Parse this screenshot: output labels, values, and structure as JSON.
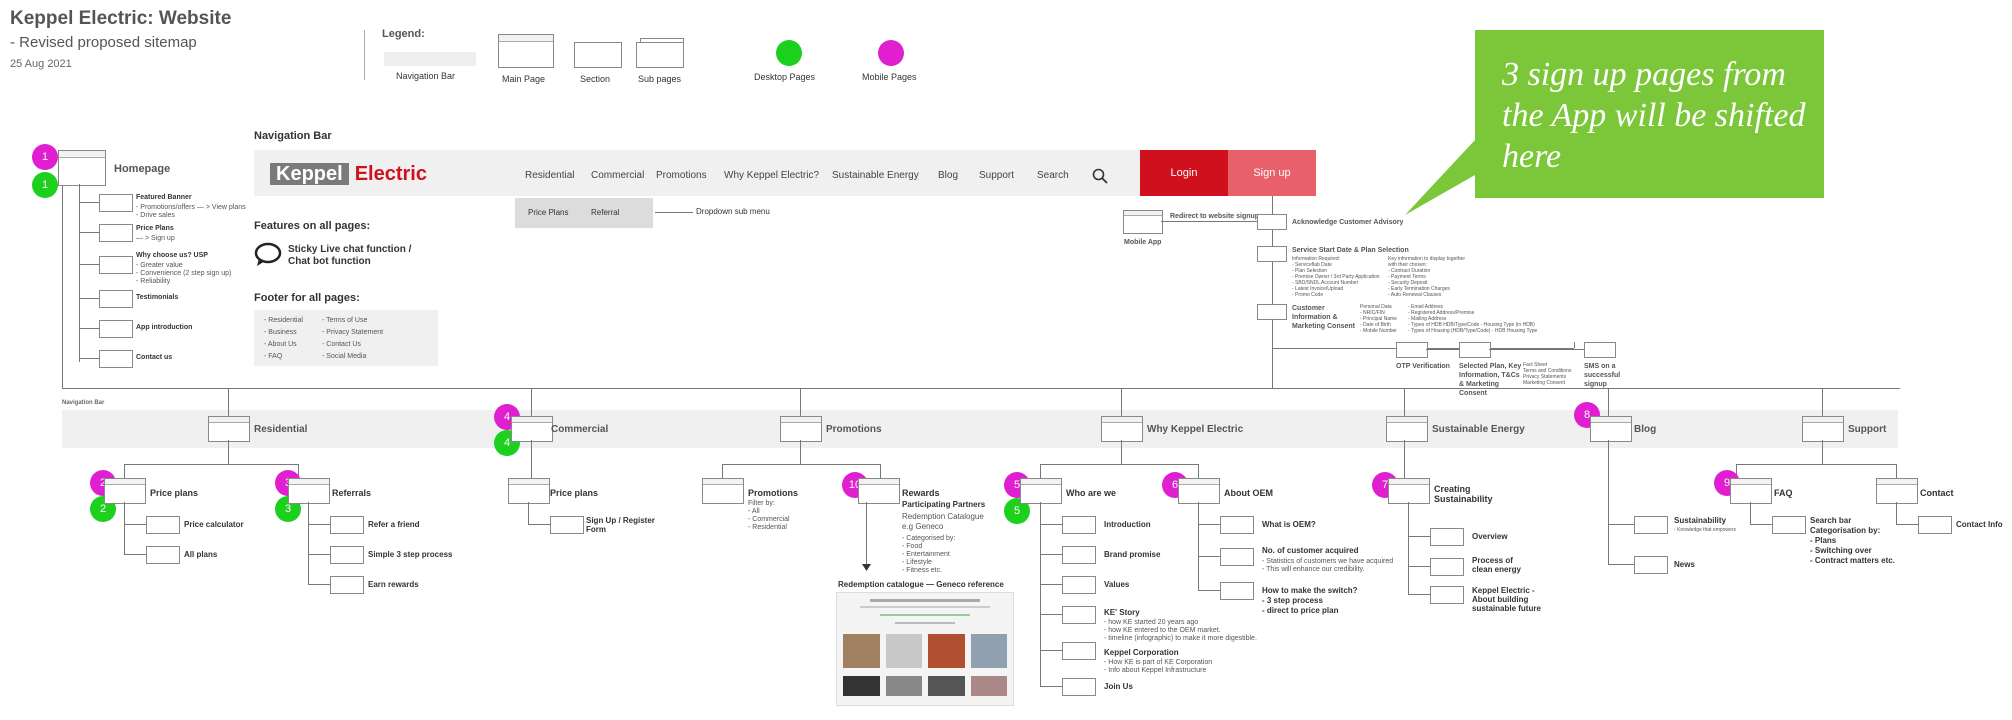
{
  "header": {
    "title": "Keppel Electric: Website",
    "subtitle": "- Revised proposed sitemap",
    "date": "25 Aug 2021"
  },
  "legend": {
    "title": "Legend:",
    "items": [
      "Navigation Bar",
      "Main Page",
      "Section",
      "Sub pages",
      "Desktop Pages",
      "Mobile Pages"
    ]
  },
  "callout": {
    "text": "3 sign up pages from the App will be shifted here",
    "color": "#7cc63a"
  },
  "navbar": {
    "section_label": "Navigation Bar",
    "logo_k": "Keppel",
    "logo_e": "Electric",
    "items": [
      "Residential",
      "Commercial",
      "Promotions",
      "Why Keppel Electric?",
      "Sustainable Energy",
      "Blog",
      "Support",
      "Search"
    ],
    "login": "Login",
    "signup": "Sign up",
    "dropdown": [
      "Price Plans",
      "Referral"
    ],
    "dropdown_label": "Dropdown sub menu",
    "colors": {
      "login": "#d0101c",
      "signup": "#e8606a",
      "logo": "#d0101c"
    }
  },
  "features": {
    "title": "Features on all pages:",
    "chat": "Sticky Live chat function / Chat bot function"
  },
  "footer": {
    "title": "Footer for all pages:",
    "col1": [
      "- Residential",
      "- Business",
      "- About Us",
      "- FAQ"
    ],
    "col2": [
      "- Terms of Use",
      "- Privacy Statement",
      "- Contact Us",
      "- Social Media"
    ]
  },
  "homepage": {
    "label": "Homepage",
    "mobile_num": "1",
    "desktop_num": "1",
    "sections": [
      {
        "title": "Featured Banner",
        "lines": [
          "- Promotions/offers  — > View plans",
          "- Drive sales"
        ]
      },
      {
        "title": "Price Plans",
        "lines": [
          "— > Sign up"
        ]
      },
      {
        "title": "Why choose us? USP",
        "lines": [
          "- Greater value",
          "- Convenience (2 step sign up)",
          "- Reliability"
        ]
      },
      {
        "title": "Testimonials",
        "lines": []
      },
      {
        "title": "App introduction",
        "lines": []
      },
      {
        "title": "Contact us",
        "lines": []
      }
    ]
  },
  "signup_flow": {
    "mobile_app": "Mobile App",
    "redirect": "Redirect to website signup",
    "steps": [
      {
        "title": "Acknowledge Customer Advisory",
        "lines": []
      },
      {
        "title": "Service Start Date & Plan Selection",
        "lines": [
          "Information Required:",
          "- Serviceflab Date",
          "- Plan Selection",
          "- Premise Owner / 3rd Party Application",
          "- SBD/SNDL Account Number",
          "- Latest Invoice/Upload",
          "- Promo Code"
        ]
      },
      {
        "title": "Customer Information & Marketing Consent",
        "lines": [
          "Personal Data",
          "- NRIC/FIN",
          "- Principal Name",
          "- Date of Birth",
          "- Mobile Number"
        ]
      }
    ],
    "key_info": [
      "Key information to display together",
      "with their chosen:",
      "- Contract Duration",
      "- Payment Terms",
      "- Security Deposit",
      "- Early Termination Charges",
      "- Auto Renewal Clauses"
    ],
    "personal_extra": [
      "- Email Address",
      "- Registered Address/Premise",
      "- Mailing Address",
      "- Types of HDB HDB/Type/Code - Housing Type (in HDB)",
      "- Types of Housing (HDB/Type/Code) - HDB Housing Type"
    ],
    "bottom": [
      {
        "title": "OTP Verification"
      },
      {
        "title": "Selected Plan, Key Information, T&Cs & Marketing Consent"
      },
      {
        "title": "SMS on a successful signup"
      }
    ],
    "fact_sheet": [
      "Fact Sheet",
      "Terms and Conditions",
      "Privacy Statements",
      "Marketing Consent"
    ]
  },
  "nav_bar_band": "Navigation Bar",
  "main_pages": [
    {
      "label": "Residential",
      "mobile_num": "",
      "desktop_num": ""
    },
    {
      "label": "Commercial",
      "mobile_num": "4",
      "desktop_num": "4"
    },
    {
      "label": "Promotions",
      "mobile_num": "",
      "desktop_num": ""
    },
    {
      "label": "Why Keppel Electric",
      "mobile_num": "",
      "desktop_num": ""
    },
    {
      "label": "Sustainable Energy",
      "mobile_num": "",
      "desktop_num": ""
    },
    {
      "label": "Blog",
      "mobile_num": "8",
      "desktop_num": ""
    },
    {
      "label": "Support",
      "mobile_num": "",
      "desktop_num": ""
    }
  ],
  "residential": {
    "price_plans": {
      "label": "Price plans",
      "mobile_num": "2",
      "desktop_num": "2",
      "subs": [
        "Price calculator",
        "All plans"
      ]
    },
    "referrals": {
      "label": "Referrals",
      "mobile_num": "3",
      "desktop_num": "3",
      "subs": [
        "Refer a friend",
        "Simple 3 step process",
        "Earn rewards"
      ]
    }
  },
  "commercial": {
    "price_plans": "Price plans",
    "sub": "Sign Up / Register Form"
  },
  "promotions": {
    "label": "Promotions",
    "filter": [
      "Filter by:",
      "- All",
      "- Commercial",
      "- Residential"
    ],
    "rewards": {
      "label": "Rewards",
      "num": "10",
      "partners": "Participating Partners",
      "catalogue": "Redemption Catalogue e.g Geneco",
      "cats": [
        "- Categorised by:",
        "- Food",
        "- Entertainment",
        "- Lifestyle",
        "- Fitness etc."
      ]
    },
    "redemption": "Redemption catalogue — Geneco reference"
  },
  "why": {
    "who": {
      "label": "Who are we",
      "mobile_num": "5",
      "desktop_num": "5",
      "subs": [
        "Introduction",
        "Brand promise",
        "Values",
        "KE' Story",
        "Keppel Corporation",
        "Join Us"
      ],
      "story": [
        "- how KE started 20 years ago",
        "- how KE entered to the OEM market.",
        "- timeline (infographic) to make it more digestible."
      ],
      "corp": [
        "- How KE is part of KE Corporation",
        "- Info about Keppel Infrastructure"
      ]
    },
    "oem": {
      "label": "About OEM",
      "mobile_num": "6",
      "subs": [
        "What is OEM?",
        "No. of customer acquired",
        "How to make the switch?"
      ],
      "acq": [
        "- Statistics of customers we have acquired",
        "- This will enhance our credibility."
      ],
      "switch": [
        "- 3 step process",
        "- direct to price plan"
      ]
    }
  },
  "sustain": {
    "label": "Creating Sustainability",
    "num": "7",
    "subs": [
      "Overview",
      "Process of clean energy",
      "Keppel Electric - About building sustainable future"
    ]
  },
  "blog": {
    "subs": [
      "Sustainability",
      "News"
    ],
    "sus_note": "- Knowledge that empowers"
  },
  "support": {
    "faq": {
      "label": "FAQ",
      "num": "9",
      "search": [
        "Search bar",
        "Categorisation by:",
        "- Plans",
        "- Switching over",
        "- Contract matters etc."
      ]
    },
    "contact": {
      "label": "Contact",
      "sub": "Contact Info"
    }
  }
}
